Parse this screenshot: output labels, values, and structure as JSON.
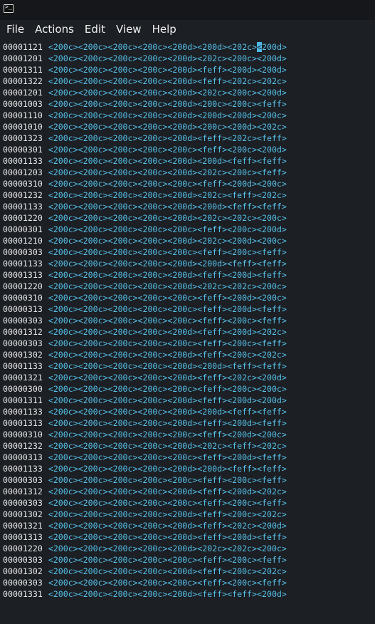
{
  "window": {
    "icon": "terminal-icon"
  },
  "menu": [
    "File",
    "Actions",
    "Edit",
    "View",
    "Help"
  ],
  "rows": [
    {
      "addr": "00001121",
      "codes": "<200c><200c><200c><200c><200d><200d><202c>",
      "cursor": "<",
      "tail": "200d>"
    },
    {
      "addr": "00001201",
      "codes": "<200c><200c><200c><200c><200d><202c><200c><200d>"
    },
    {
      "addr": "00001311",
      "codes": "<200c><200c><200c><200c><200d><feff><200d><200d>"
    },
    {
      "addr": "00001322",
      "codes": "<200c><200c><200c><200c><200d><feff><202c><202c>"
    },
    {
      "addr": "00001201",
      "codes": "<200c><200c><200c><200c><200d><202c><200c><200d>"
    },
    {
      "addr": "00001003",
      "codes": "<200c><200c><200c><200c><200d><200c><200c><feff>"
    },
    {
      "addr": "00001110",
      "codes": "<200c><200c><200c><200c><200d><200d><200d><200c>"
    },
    {
      "addr": "00001010",
      "codes": "<200c><200c><200c><200c><200d><200c><200d><202c>"
    },
    {
      "addr": "00001323",
      "codes": "<200c><200c><200c><200c><200d><feff><202c><feff>"
    },
    {
      "addr": "00000301",
      "codes": "<200c><200c><200c><200c><200c><feff><200c><200d>"
    },
    {
      "addr": "00001133",
      "codes": "<200c><200c><200c><200c><200d><200d><feff><feff>"
    },
    {
      "addr": "00001203",
      "codes": "<200c><200c><200c><200c><200d><202c><200c><feff>"
    },
    {
      "addr": "00000310",
      "codes": "<200c><200c><200c><200c><200c><feff><200d><200c>"
    },
    {
      "addr": "00001232",
      "codes": "<200c><200c><200c><200c><200d><202c><feff><202c>"
    },
    {
      "addr": "00001133",
      "codes": "<200c><200c><200c><200c><200d><200d><feff><feff>"
    },
    {
      "addr": "00001220",
      "codes": "<200c><200c><200c><200c><200d><202c><202c><200c>"
    },
    {
      "addr": "00000301",
      "codes": "<200c><200c><200c><200c><200c><feff><200c><200d>"
    },
    {
      "addr": "00001210",
      "codes": "<200c><200c><200c><200c><200d><202c><200d><200c>"
    },
    {
      "addr": "00000303",
      "codes": "<200c><200c><200c><200c><200c><feff><200c><feff>"
    },
    {
      "addr": "00001133",
      "codes": "<200c><200c><200c><200c><200d><200d><feff><feff>"
    },
    {
      "addr": "00001313",
      "codes": "<200c><200c><200c><200c><200d><feff><200d><feff>"
    },
    {
      "addr": "00001220",
      "codes": "<200c><200c><200c><200c><200d><202c><202c><200c>"
    },
    {
      "addr": "00000310",
      "codes": "<200c><200c><200c><200c><200c><feff><200d><200c>"
    },
    {
      "addr": "00000313",
      "codes": "<200c><200c><200c><200c><200c><feff><200d><feff>"
    },
    {
      "addr": "00000303",
      "codes": "<200c><200c><200c><200c><200c><feff><200c><feff>"
    },
    {
      "addr": "00001312",
      "codes": "<200c><200c><200c><200c><200d><feff><200d><202c>"
    },
    {
      "addr": "00000303",
      "codes": "<200c><200c><200c><200c><200c><feff><200c><feff>"
    },
    {
      "addr": "00001302",
      "codes": "<200c><200c><200c><200c><200d><feff><200c><202c>"
    },
    {
      "addr": "00001133",
      "codes": "<200c><200c><200c><200c><200d><200d><feff><feff>"
    },
    {
      "addr": "00001321",
      "codes": "<200c><200c><200c><200c><200d><feff><202c><200d>"
    },
    {
      "addr": "00000300",
      "codes": "<200c><200c><200c><200c><200c><feff><200c><200c>"
    },
    {
      "addr": "00001311",
      "codes": "<200c><200c><200c><200c><200d><feff><200d><200d>"
    },
    {
      "addr": "00001133",
      "codes": "<200c><200c><200c><200c><200d><200d><feff><feff>"
    },
    {
      "addr": "00001313",
      "codes": "<200c><200c><200c><200c><200d><feff><200d><feff>"
    },
    {
      "addr": "00000310",
      "codes": "<200c><200c><200c><200c><200c><feff><200d><200c>"
    },
    {
      "addr": "00001232",
      "codes": "<200c><200c><200c><200c><200d><202c><feff><202c>"
    },
    {
      "addr": "00000313",
      "codes": "<200c><200c><200c><200c><200c><feff><200d><feff>"
    },
    {
      "addr": "00001133",
      "codes": "<200c><200c><200c><200c><200d><200d><feff><feff>"
    },
    {
      "addr": "00000303",
      "codes": "<200c><200c><200c><200c><200c><feff><200c><feff>"
    },
    {
      "addr": "00001312",
      "codes": "<200c><200c><200c><200c><200d><feff><200d><202c>"
    },
    {
      "addr": "00000303",
      "codes": "<200c><200c><200c><200c><200c><feff><200c><feff>"
    },
    {
      "addr": "00001302",
      "codes": "<200c><200c><200c><200c><200d><feff><200c><202c>"
    },
    {
      "addr": "00001321",
      "codes": "<200c><200c><200c><200c><200d><feff><202c><200d>"
    },
    {
      "addr": "00001313",
      "codes": "<200c><200c><200c><200c><200d><feff><200d><feff>"
    },
    {
      "addr": "00001220",
      "codes": "<200c><200c><200c><200c><200d><202c><202c><200c>"
    },
    {
      "addr": "00000303",
      "codes": "<200c><200c><200c><200c><200c><feff><200c><feff>"
    },
    {
      "addr": "00001302",
      "codes": "<200c><200c><200c><200c><200d><feff><200c><202c>"
    },
    {
      "addr": "00000303",
      "codes": "<200c><200c><200c><200c><200c><feff><200c><feff>"
    },
    {
      "addr": "00001331",
      "codes": "<200c><200c><200c><200c><200d><feff><feff><200d>"
    }
  ]
}
